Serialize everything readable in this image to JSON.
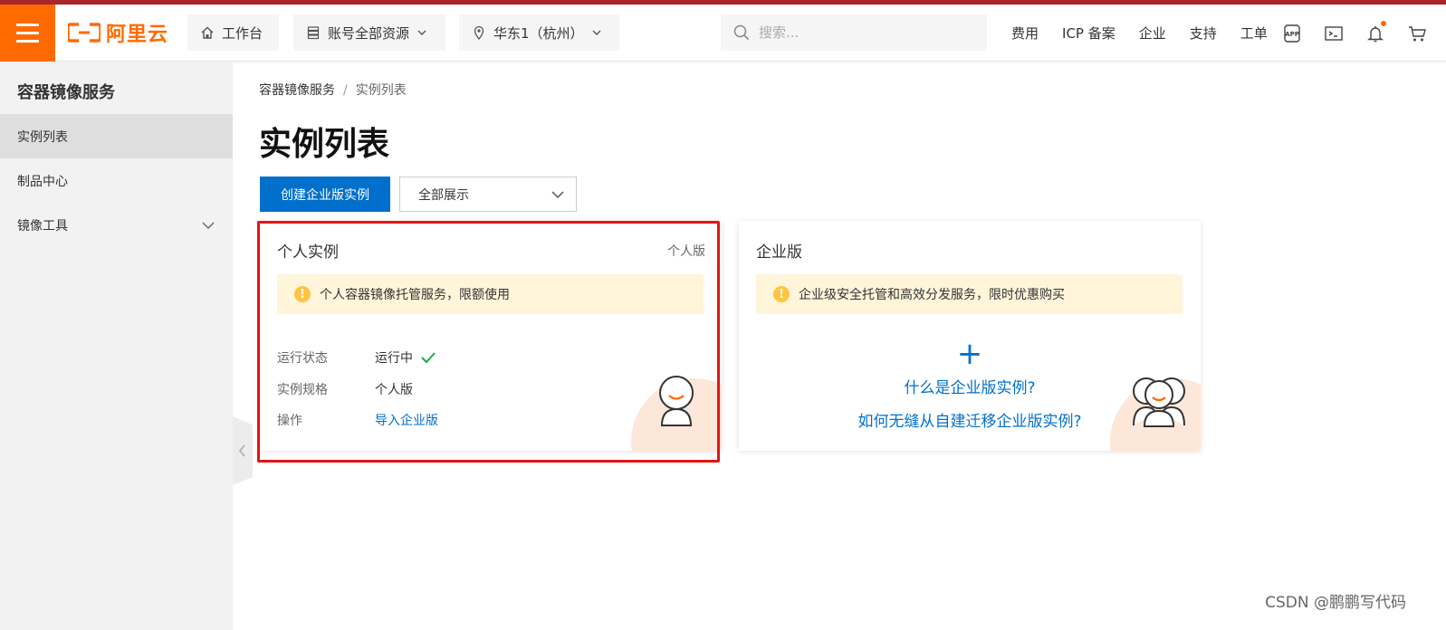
{
  "topbar": {
    "brand": "阿里云",
    "nav": {
      "workbench": "工作台",
      "account_resources": "账号全部资源",
      "region": "华东1（杭州）"
    },
    "search": {
      "placeholder": "搜索..."
    },
    "links": [
      "费用",
      "ICP 备案",
      "企业",
      "支持",
      "工单"
    ],
    "icons": [
      "app-icon",
      "terminal-icon",
      "bell-icon",
      "cart-icon"
    ]
  },
  "sidebar": {
    "title": "容器镜像服务",
    "items": [
      {
        "label": "实例列表",
        "active": true
      },
      {
        "label": "制品中心",
        "active": false
      },
      {
        "label": "镜像工具",
        "active": false,
        "expandable": true
      }
    ]
  },
  "breadcrumb": {
    "root": "容器镜像服务",
    "separator": "/",
    "current": "实例列表"
  },
  "page": {
    "title": "实例列表",
    "create_button": "创建企业版实例",
    "filter_value": "全部展示"
  },
  "cards": {
    "personal": {
      "title": "个人实例",
      "tag": "个人版",
      "alert": "个人容器镜像托管服务，限额使用",
      "rows": {
        "status_label": "运行状态",
        "status_value": "运行中",
        "spec_label": "实例规格",
        "spec_value": "个人版",
        "action_label": "操作",
        "action_link": "导入企业版"
      }
    },
    "enterprise": {
      "title": "企业版",
      "alert": "企业级安全托管和高效分发服务，限时优惠购买",
      "plus": "+",
      "link1": "什么是企业版实例?",
      "link2": "如何无缝从自建迁移企业版实例?"
    }
  },
  "watermark": "CSDN @鹏鹏写代码",
  "colors": {
    "brand": "#ff6a00",
    "primary": "#0070cc",
    "highlight": "#e31515",
    "alert_bg": "#fff5da",
    "success": "#1aab4b"
  }
}
